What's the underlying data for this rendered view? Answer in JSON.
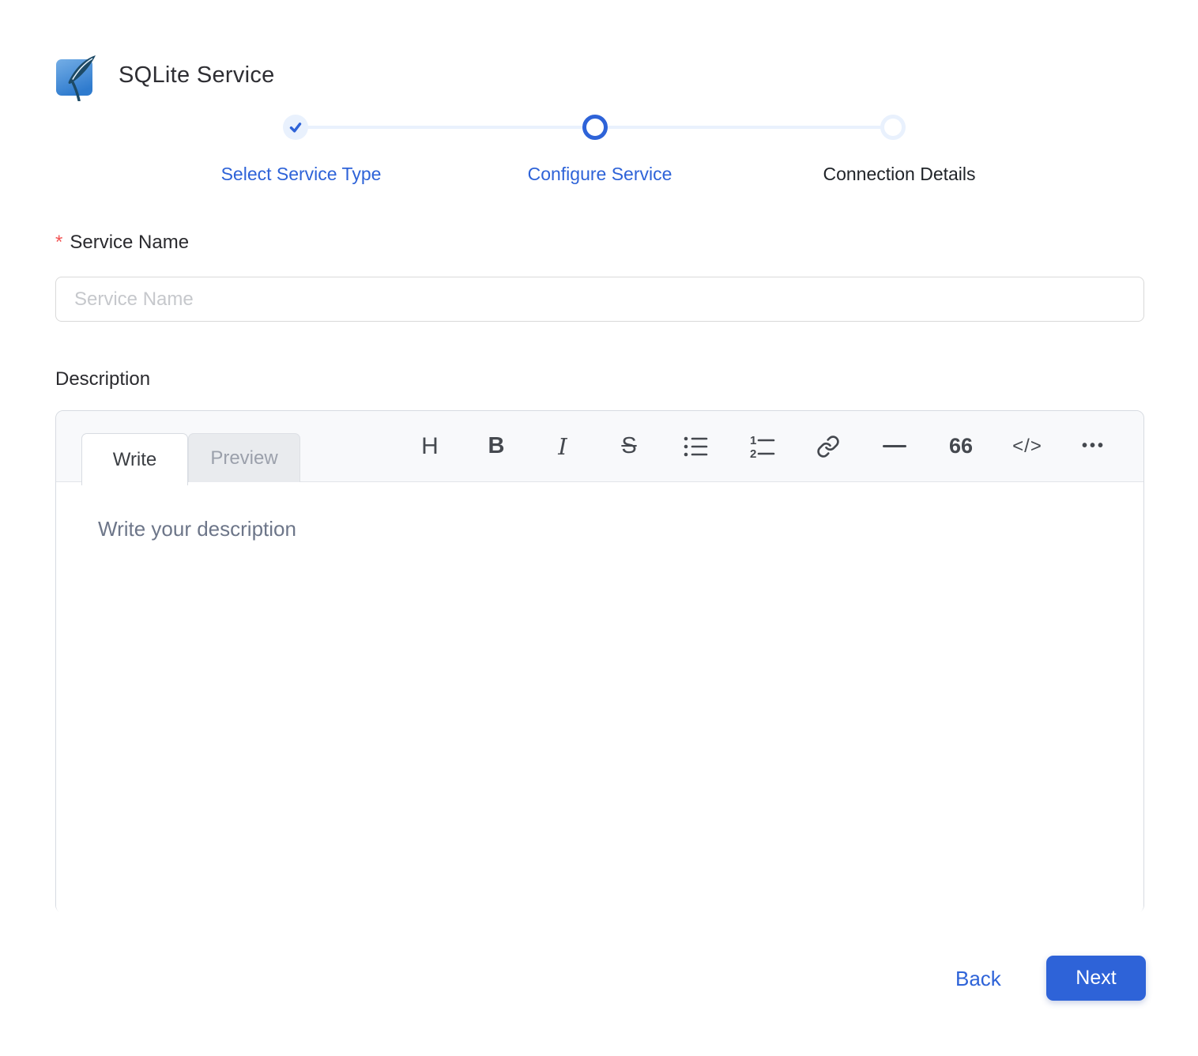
{
  "header": {
    "title": "SQLite Service"
  },
  "stepper": {
    "steps": [
      {
        "label": "Select Service Type",
        "state": "completed"
      },
      {
        "label": "Configure Service",
        "state": "active"
      },
      {
        "label": "Connection Details",
        "state": "pending"
      }
    ]
  },
  "form": {
    "service_name": {
      "label": "Service Name",
      "required_marker": "*",
      "placeholder": "Service Name",
      "value": ""
    },
    "description": {
      "label": "Description"
    }
  },
  "editor": {
    "tabs": [
      {
        "label": "Write",
        "active": true
      },
      {
        "label": "Preview",
        "active": false
      }
    ],
    "placeholder": "Write your description",
    "value": "",
    "toolbar": {
      "heading": "H",
      "bold": "B",
      "italic": "I",
      "strikethrough": "S",
      "quote": "66",
      "code": "</>",
      "more": "•••"
    },
    "toolbar_icons": [
      "heading-icon",
      "bold-icon",
      "italic-icon",
      "strikethrough-icon",
      "bullet-list-icon",
      "ordered-list-icon",
      "link-icon",
      "horizontal-rule-icon",
      "quote-icon",
      "code-icon",
      "more-icon"
    ]
  },
  "footer": {
    "back": "Back",
    "next": "Next"
  },
  "colors": {
    "primary": "#2E63D8",
    "step_inactive": "#e9f1fd",
    "asterisk": "#F25555",
    "toolbar_bg": "#f8f9fb",
    "border": "#d7dbe1",
    "placeholder": "#c6c8cc",
    "editor_placeholder": "#6d7689"
  }
}
